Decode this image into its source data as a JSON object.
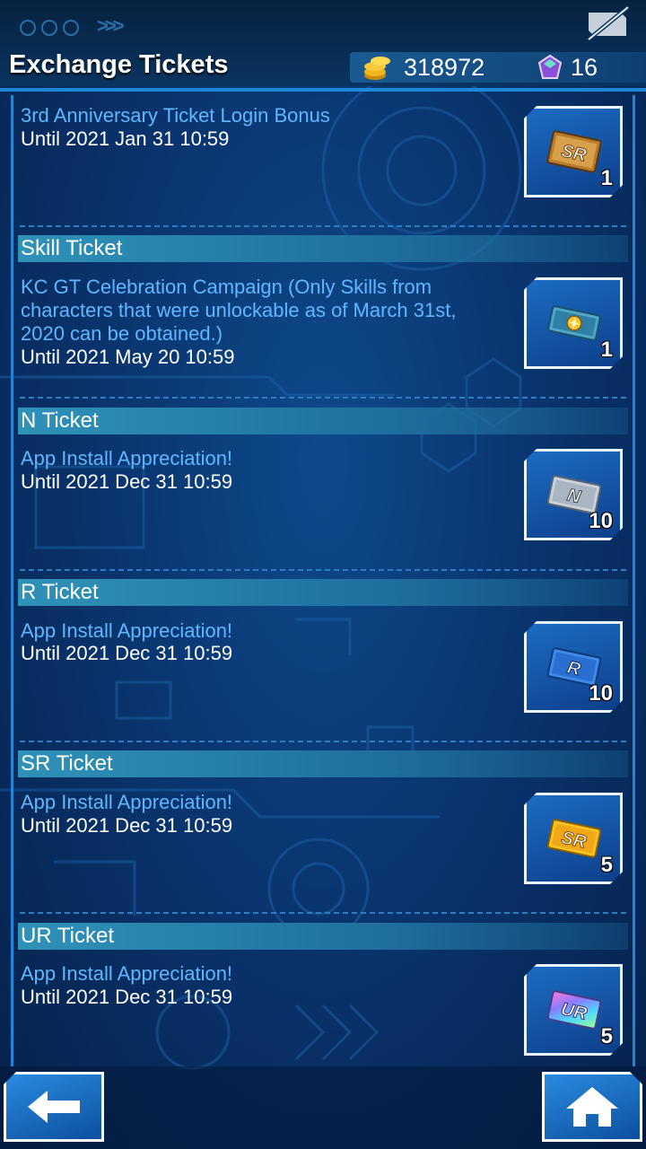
{
  "header": {
    "title": "Exchange Tickets",
    "gold": "318972",
    "gems": "16"
  },
  "entries": [
    {
      "section": "",
      "title": "3rd Anniversary Ticket Login Bonus",
      "until": "Until 2021 Jan 31 10:59",
      "reward": {
        "ticket": "SR",
        "count": "1",
        "icon": "sr-gold-ticket-icon"
      }
    },
    {
      "section": "Skill Ticket",
      "title": "KC GT Celebration Campaign (Only Skills from characters that were unlockable as of March 31st, 2020 can be obtained.)",
      "until": "Until 2021 May 20 10:59",
      "reward": {
        "ticket": "",
        "count": "1",
        "icon": "skill-ticket-icon"
      }
    },
    {
      "section": "N Ticket",
      "title": "App Install Appreciation!",
      "until": "Until 2021 Dec 31 10:59",
      "reward": {
        "ticket": "N",
        "count": "10",
        "icon": "n-ticket-icon"
      }
    },
    {
      "section": "R Ticket",
      "title": "App Install Appreciation!",
      "until": "Until 2021 Dec 31 10:59",
      "reward": {
        "ticket": "R",
        "count": "10",
        "icon": "r-ticket-icon"
      }
    },
    {
      "section": "SR Ticket",
      "title": "App Install Appreciation!",
      "until": "Until 2021 Dec 31 10:59",
      "reward": {
        "ticket": "SR",
        "count": "5",
        "icon": "sr-ticket-icon"
      }
    },
    {
      "section": "UR Ticket",
      "title": "App Install Appreciation!",
      "until": "Until 2021 Dec 31 10:59",
      "reward": {
        "ticket": "UR",
        "count": "5",
        "icon": "ur-ticket-icon"
      }
    }
  ],
  "colors": {
    "accent": "#1e88d8",
    "link_text": "#5fb8ff",
    "header_bar": "#2f92b8"
  }
}
